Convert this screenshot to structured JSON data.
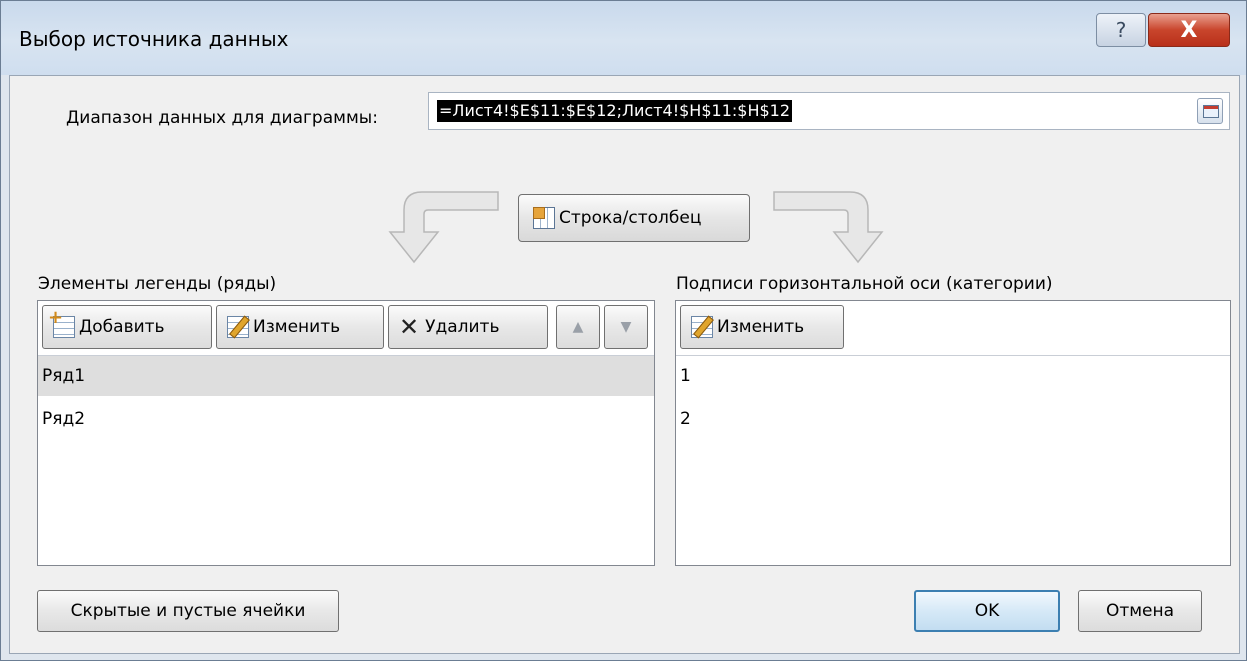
{
  "window": {
    "title": "Выбор источника данных"
  },
  "titlebar": {
    "help_glyph": "?",
    "close_glyph": "X"
  },
  "range": {
    "label": "Диапазон данных для диаграммы:",
    "value": "=Лист4!$E$11:$E$12;Лист4!$H$11:$H$12"
  },
  "switch_button": {
    "label": "Строка/столбец",
    "icon": "switch-row-column-icon"
  },
  "legend": {
    "label": "Элементы легенды (ряды)",
    "buttons": {
      "add": "Добавить",
      "edit": "Изменить",
      "delete": "Удалить",
      "up": "▲",
      "down": "▼"
    },
    "items": [
      {
        "label": "Ряд1",
        "selected": true
      },
      {
        "label": "Ряд2",
        "selected": false
      }
    ]
  },
  "categories": {
    "label": "Подписи горизонтальной оси (категории)",
    "buttons": {
      "edit": "Изменить"
    },
    "items": [
      "1",
      "2"
    ]
  },
  "footer": {
    "hidden_cells": "Скрытые и пустые ячейки",
    "ok": "OK",
    "cancel": "Отмена"
  },
  "colors": {
    "selection": "#000000",
    "selected_row": "#dedede",
    "close": "#c9452c",
    "ok_border": "#3c7fb1"
  }
}
